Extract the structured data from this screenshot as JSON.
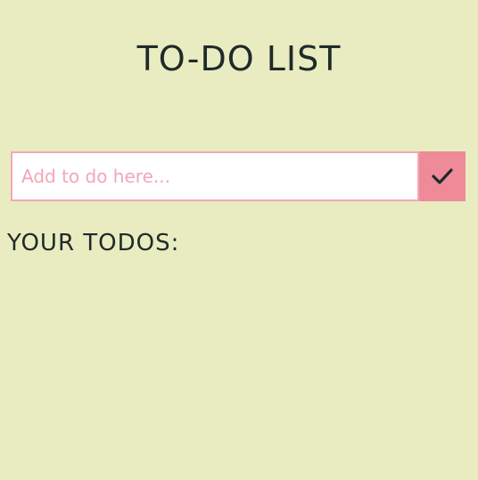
{
  "header": {
    "title": "TO-DO LIST"
  },
  "new_todo": {
    "placeholder": "Add to do here...",
    "value": "",
    "submit_icon": "checkmark-icon"
  },
  "todos": {
    "heading": "YOUR TODOS:",
    "items": []
  },
  "colors": {
    "background": "#e8ecc0",
    "accent": "#ef8a99",
    "input_border": "#f4a8b8",
    "placeholder": "#f2a7b6",
    "text": "#1f2a2a"
  }
}
